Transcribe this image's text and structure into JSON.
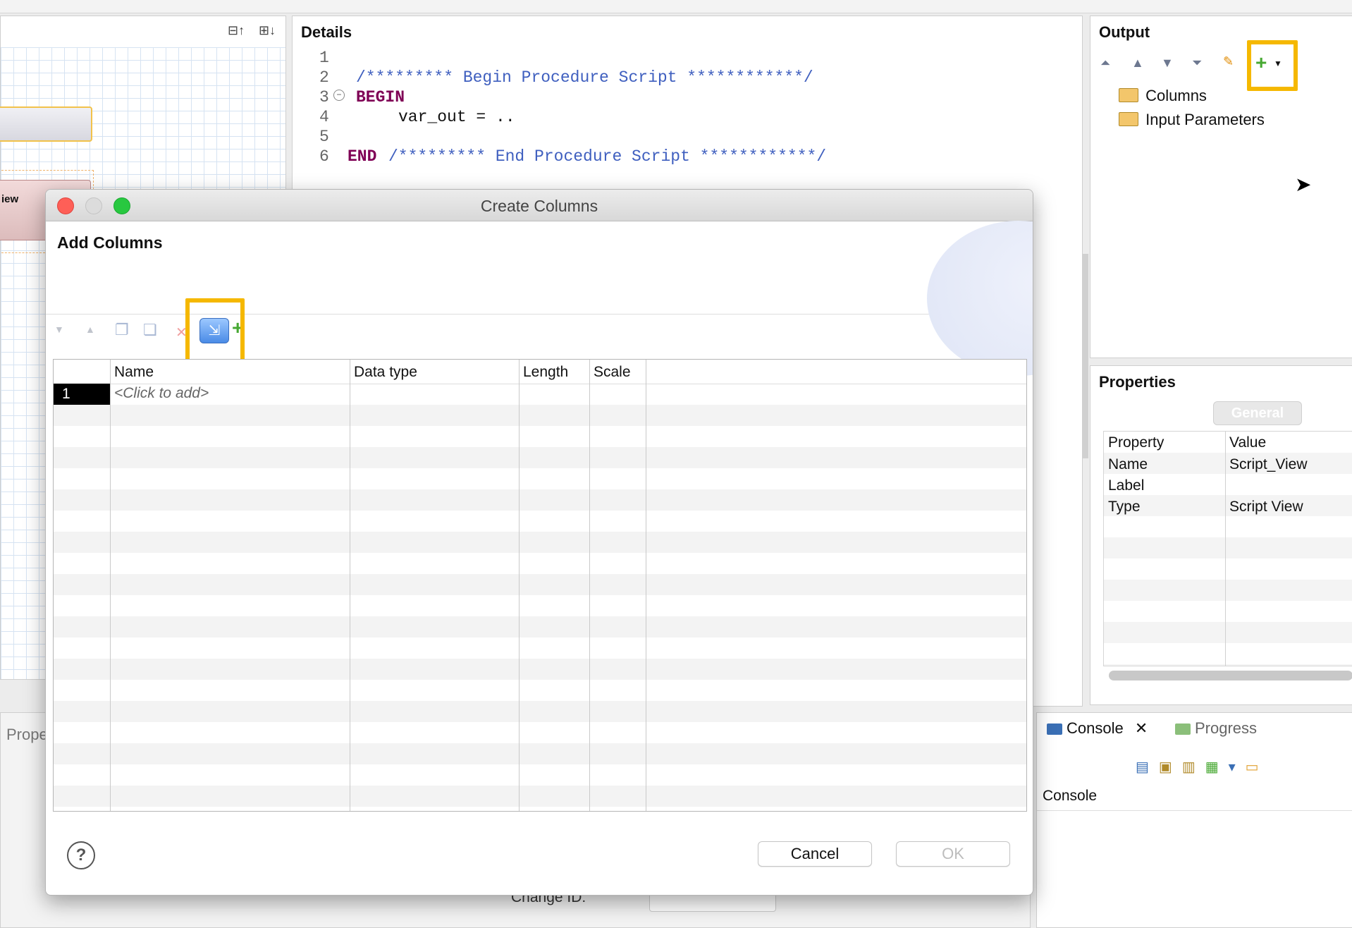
{
  "details": {
    "title": "Details",
    "lines": [
      {
        "num": "1",
        "text": ""
      },
      {
        "num": "2",
        "text": "/********* Begin Procedure Script ************/"
      },
      {
        "num": "3",
        "text": "BEGIN"
      },
      {
        "num": "4",
        "text": "var_out = .."
      },
      {
        "num": "5",
        "text": ""
      },
      {
        "num": "6",
        "kw": "END",
        "text": "/********* End Procedure Script ************/"
      }
    ]
  },
  "left_panel": {
    "node_label": "iew",
    "bottom_tab": "Prope"
  },
  "output": {
    "title": "Output",
    "tree": [
      "Columns",
      "Input Parameters"
    ]
  },
  "properties": {
    "title": "Properties",
    "tab": "General",
    "headers": [
      "Property",
      "Value"
    ],
    "rows": [
      [
        "Name",
        "Script_View"
      ],
      [
        "Label",
        ""
      ],
      [
        "Type",
        "Script View"
      ]
    ]
  },
  "console": {
    "tab_console": "Console",
    "tab_progress": "Progress",
    "label": "Console"
  },
  "background_field": "Change ID:",
  "dialog": {
    "window_title": "Create Columns",
    "heading": "Add Columns",
    "table": {
      "headers": [
        "Name",
        "Data type",
        "Length",
        "Scale"
      ],
      "first_row_num": "1",
      "first_row_placeholder": "<Click to add>"
    },
    "help_icon": "?",
    "cancel_label": "Cancel",
    "ok_label": "OK"
  },
  "colors": {
    "highlight": "#f5b800",
    "keyword": "#7f0055",
    "comment": "#3f5fbf",
    "selection": "#000000"
  }
}
